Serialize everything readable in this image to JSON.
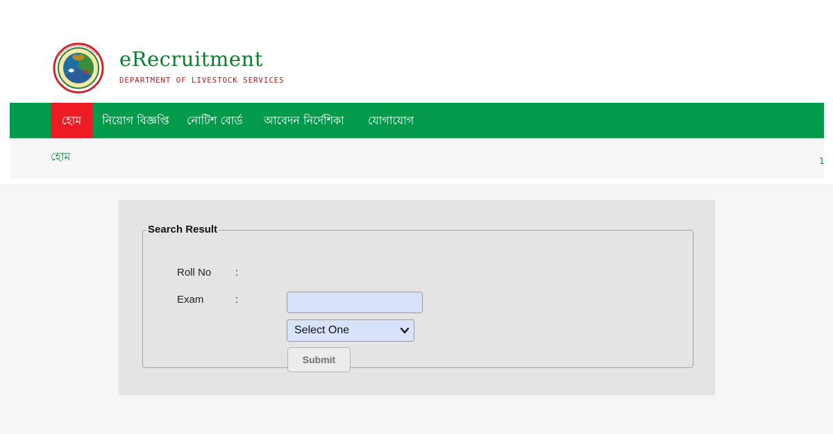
{
  "header": {
    "brand_title": "eRecruitment",
    "brand_subtitle": "DEPARTMENT OF LIVESTOCK SERVICES",
    "brand_color": "#0b7d2e",
    "subtitle_color": "#b01f1f"
  },
  "nav": {
    "items": [
      {
        "label": "হোম",
        "active": true
      },
      {
        "label": "নিয়োগ বিজ্ঞপ্তি",
        "active": false
      },
      {
        "label": "নোটিশ বোর্ড",
        "active": false
      },
      {
        "label": "আবেদন নির্দেশিকা",
        "active": false
      },
      {
        "label": "যোগাযোগ",
        "active": false
      }
    ],
    "bar_color": "#039a4c",
    "active_color": "#ed1c24"
  },
  "breadcrumb": {
    "home": "হোম",
    "edge_char": "1"
  },
  "form": {
    "legend": "Search Result",
    "roll_label": "Roll No",
    "exam_label": "Exam",
    "separator": ":",
    "roll_value": "",
    "exam_selected": "Select One",
    "submit_label": "Submit",
    "input_bg": "#d8e2fb"
  },
  "icons": {
    "logo": "livestock-seal-logo",
    "select": "chevron-down-icon"
  }
}
